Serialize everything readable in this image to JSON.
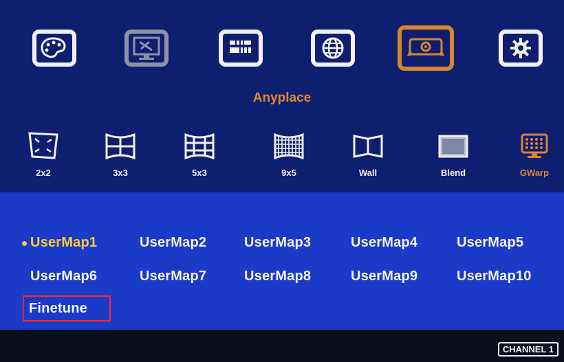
{
  "top_menu": {
    "title": "Anyplace",
    "icons": [
      {
        "name": "palette-icon"
      },
      {
        "name": "monitor-settings-icon"
      },
      {
        "name": "layout-bars-icon"
      },
      {
        "name": "globe-icon"
      },
      {
        "name": "projector-icon",
        "active": true
      },
      {
        "name": "gear-icon"
      }
    ]
  },
  "modes": [
    {
      "label": "2x2"
    },
    {
      "label": "3x3"
    },
    {
      "label": "5x3"
    },
    {
      "label": "9x5"
    },
    {
      "label": "Wall"
    },
    {
      "label": "Blend"
    },
    {
      "label": "GWarp",
      "active": true
    }
  ],
  "user_maps": {
    "selected": "UserMap1",
    "items": [
      "UserMap1",
      "UserMap2",
      "UserMap3",
      "UserMap4",
      "UserMap5",
      "UserMap6",
      "UserMap7",
      "UserMap8",
      "UserMap9",
      "UserMap10"
    ],
    "finetune": "Finetune"
  },
  "status": {
    "channel": "CHANNEL 1"
  },
  "colors": {
    "accent": "#e0872f",
    "panel": "#1a3ac8",
    "header": "#0f1f70",
    "highlight": "#ffcc33",
    "focus": "#ff2a2a"
  }
}
